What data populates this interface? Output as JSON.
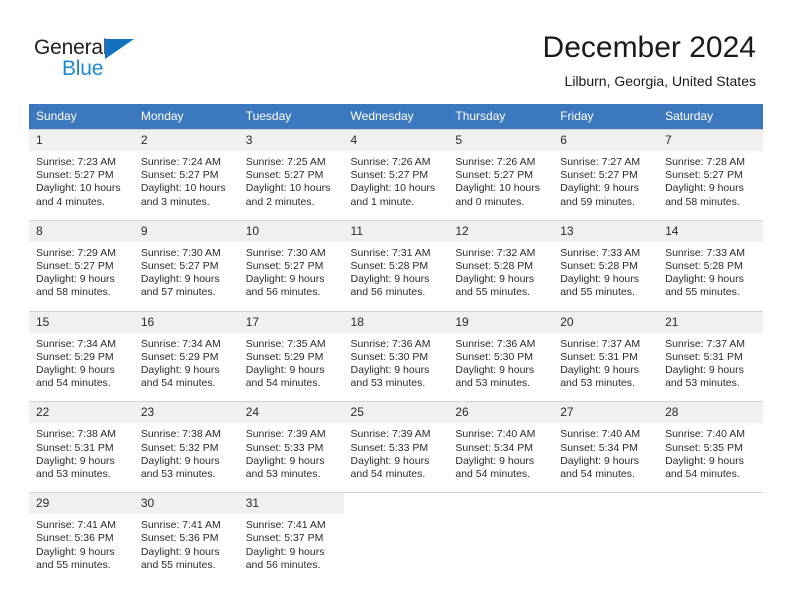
{
  "brand": {
    "name_part1": "General",
    "name_part2": "Blue",
    "triangle_icon": "triangle-icon",
    "colors": {
      "dark": "#231f20",
      "blue": "#1f8ad6",
      "triangle": "#1272c0"
    }
  },
  "header": {
    "title": "December 2024",
    "location": "Lilburn, Georgia, United States"
  },
  "calendar": {
    "header_background": "#3b78bd",
    "daynum_background": "#f0f0f0",
    "weekdays": [
      "Sunday",
      "Monday",
      "Tuesday",
      "Wednesday",
      "Thursday",
      "Friday",
      "Saturday"
    ],
    "weeks": [
      [
        {
          "day": "1",
          "sunrise": "Sunrise: 7:23 AM",
          "sunset": "Sunset: 5:27 PM",
          "daylight1": "Daylight: 10 hours",
          "daylight2": "and 4 minutes."
        },
        {
          "day": "2",
          "sunrise": "Sunrise: 7:24 AM",
          "sunset": "Sunset: 5:27 PM",
          "daylight1": "Daylight: 10 hours",
          "daylight2": "and 3 minutes."
        },
        {
          "day": "3",
          "sunrise": "Sunrise: 7:25 AM",
          "sunset": "Sunset: 5:27 PM",
          "daylight1": "Daylight: 10 hours",
          "daylight2": "and 2 minutes."
        },
        {
          "day": "4",
          "sunrise": "Sunrise: 7:26 AM",
          "sunset": "Sunset: 5:27 PM",
          "daylight1": "Daylight: 10 hours",
          "daylight2": "and 1 minute."
        },
        {
          "day": "5",
          "sunrise": "Sunrise: 7:26 AM",
          "sunset": "Sunset: 5:27 PM",
          "daylight1": "Daylight: 10 hours",
          "daylight2": "and 0 minutes."
        },
        {
          "day": "6",
          "sunrise": "Sunrise: 7:27 AM",
          "sunset": "Sunset: 5:27 PM",
          "daylight1": "Daylight: 9 hours",
          "daylight2": "and 59 minutes."
        },
        {
          "day": "7",
          "sunrise": "Sunrise: 7:28 AM",
          "sunset": "Sunset: 5:27 PM",
          "daylight1": "Daylight: 9 hours",
          "daylight2": "and 58 minutes."
        }
      ],
      [
        {
          "day": "8",
          "sunrise": "Sunrise: 7:29 AM",
          "sunset": "Sunset: 5:27 PM",
          "daylight1": "Daylight: 9 hours",
          "daylight2": "and 58 minutes."
        },
        {
          "day": "9",
          "sunrise": "Sunrise: 7:30 AM",
          "sunset": "Sunset: 5:27 PM",
          "daylight1": "Daylight: 9 hours",
          "daylight2": "and 57 minutes."
        },
        {
          "day": "10",
          "sunrise": "Sunrise: 7:30 AM",
          "sunset": "Sunset: 5:27 PM",
          "daylight1": "Daylight: 9 hours",
          "daylight2": "and 56 minutes."
        },
        {
          "day": "11",
          "sunrise": "Sunrise: 7:31 AM",
          "sunset": "Sunset: 5:28 PM",
          "daylight1": "Daylight: 9 hours",
          "daylight2": "and 56 minutes."
        },
        {
          "day": "12",
          "sunrise": "Sunrise: 7:32 AM",
          "sunset": "Sunset: 5:28 PM",
          "daylight1": "Daylight: 9 hours",
          "daylight2": "and 55 minutes."
        },
        {
          "day": "13",
          "sunrise": "Sunrise: 7:33 AM",
          "sunset": "Sunset: 5:28 PM",
          "daylight1": "Daylight: 9 hours",
          "daylight2": "and 55 minutes."
        },
        {
          "day": "14",
          "sunrise": "Sunrise: 7:33 AM",
          "sunset": "Sunset: 5:28 PM",
          "daylight1": "Daylight: 9 hours",
          "daylight2": "and 55 minutes."
        }
      ],
      [
        {
          "day": "15",
          "sunrise": "Sunrise: 7:34 AM",
          "sunset": "Sunset: 5:29 PM",
          "daylight1": "Daylight: 9 hours",
          "daylight2": "and 54 minutes."
        },
        {
          "day": "16",
          "sunrise": "Sunrise: 7:34 AM",
          "sunset": "Sunset: 5:29 PM",
          "daylight1": "Daylight: 9 hours",
          "daylight2": "and 54 minutes."
        },
        {
          "day": "17",
          "sunrise": "Sunrise: 7:35 AM",
          "sunset": "Sunset: 5:29 PM",
          "daylight1": "Daylight: 9 hours",
          "daylight2": "and 54 minutes."
        },
        {
          "day": "18",
          "sunrise": "Sunrise: 7:36 AM",
          "sunset": "Sunset: 5:30 PM",
          "daylight1": "Daylight: 9 hours",
          "daylight2": "and 53 minutes."
        },
        {
          "day": "19",
          "sunrise": "Sunrise: 7:36 AM",
          "sunset": "Sunset: 5:30 PM",
          "daylight1": "Daylight: 9 hours",
          "daylight2": "and 53 minutes."
        },
        {
          "day": "20",
          "sunrise": "Sunrise: 7:37 AM",
          "sunset": "Sunset: 5:31 PM",
          "daylight1": "Daylight: 9 hours",
          "daylight2": "and 53 minutes."
        },
        {
          "day": "21",
          "sunrise": "Sunrise: 7:37 AM",
          "sunset": "Sunset: 5:31 PM",
          "daylight1": "Daylight: 9 hours",
          "daylight2": "and 53 minutes."
        }
      ],
      [
        {
          "day": "22",
          "sunrise": "Sunrise: 7:38 AM",
          "sunset": "Sunset: 5:31 PM",
          "daylight1": "Daylight: 9 hours",
          "daylight2": "and 53 minutes."
        },
        {
          "day": "23",
          "sunrise": "Sunrise: 7:38 AM",
          "sunset": "Sunset: 5:32 PM",
          "daylight1": "Daylight: 9 hours",
          "daylight2": "and 53 minutes."
        },
        {
          "day": "24",
          "sunrise": "Sunrise: 7:39 AM",
          "sunset": "Sunset: 5:33 PM",
          "daylight1": "Daylight: 9 hours",
          "daylight2": "and 53 minutes."
        },
        {
          "day": "25",
          "sunrise": "Sunrise: 7:39 AM",
          "sunset": "Sunset: 5:33 PM",
          "daylight1": "Daylight: 9 hours",
          "daylight2": "and 54 minutes."
        },
        {
          "day": "26",
          "sunrise": "Sunrise: 7:40 AM",
          "sunset": "Sunset: 5:34 PM",
          "daylight1": "Daylight: 9 hours",
          "daylight2": "and 54 minutes."
        },
        {
          "day": "27",
          "sunrise": "Sunrise: 7:40 AM",
          "sunset": "Sunset: 5:34 PM",
          "daylight1": "Daylight: 9 hours",
          "daylight2": "and 54 minutes."
        },
        {
          "day": "28",
          "sunrise": "Sunrise: 7:40 AM",
          "sunset": "Sunset: 5:35 PM",
          "daylight1": "Daylight: 9 hours",
          "daylight2": "and 54 minutes."
        }
      ],
      [
        {
          "day": "29",
          "sunrise": "Sunrise: 7:41 AM",
          "sunset": "Sunset: 5:36 PM",
          "daylight1": "Daylight: 9 hours",
          "daylight2": "and 55 minutes."
        },
        {
          "day": "30",
          "sunrise": "Sunrise: 7:41 AM",
          "sunset": "Sunset: 5:36 PM",
          "daylight1": "Daylight: 9 hours",
          "daylight2": "and 55 minutes."
        },
        {
          "day": "31",
          "sunrise": "Sunrise: 7:41 AM",
          "sunset": "Sunset: 5:37 PM",
          "daylight1": "Daylight: 9 hours",
          "daylight2": "and 56 minutes."
        },
        {
          "day": "",
          "sunrise": "",
          "sunset": "",
          "daylight1": "",
          "daylight2": "",
          "blank": true
        },
        {
          "day": "",
          "sunrise": "",
          "sunset": "",
          "daylight1": "",
          "daylight2": "",
          "blank": true
        },
        {
          "day": "",
          "sunrise": "",
          "sunset": "",
          "daylight1": "",
          "daylight2": "",
          "blank": true
        },
        {
          "day": "",
          "sunrise": "",
          "sunset": "",
          "daylight1": "",
          "daylight2": "",
          "blank": true
        }
      ]
    ]
  }
}
